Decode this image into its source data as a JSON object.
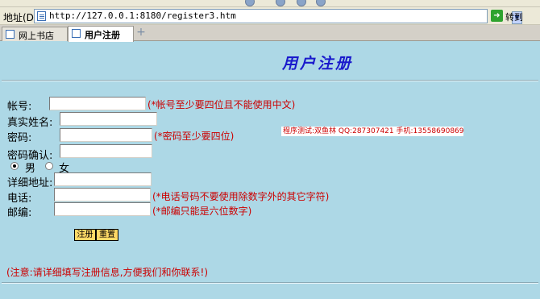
{
  "browser": {
    "address_label": "地址(D)",
    "url": "http://127.0.0.1:8180/register3.htm",
    "go_label": "转到"
  },
  "tabs": [
    {
      "label": "网上书店"
    },
    {
      "label": "用户注册"
    }
  ],
  "form": {
    "title": "用户注册",
    "fields": {
      "account": {
        "label": "帐号:",
        "value": "",
        "hint": "(*帐号至少要四位且不能使用中文)"
      },
      "realname": {
        "label": "真实姓名:",
        "value": ""
      },
      "password": {
        "label": "密码:",
        "value": "",
        "hint": "(*密码至少要四位)"
      },
      "password_confirm": {
        "label": "密码确认:",
        "value": ""
      },
      "address": {
        "label": "详细地址:",
        "value": ""
      },
      "phone": {
        "label": "电话:",
        "value": "",
        "hint": "(*电话号码不要使用除数字外的其它字符)"
      },
      "zipcode": {
        "label": "邮编:",
        "value": "",
        "hint": "(*邮编只能是六位数字)"
      }
    },
    "gender": {
      "options": [
        {
          "label": "男",
          "selected": true
        },
        {
          "label": "女",
          "selected": false
        }
      ]
    },
    "buttons": {
      "submit": "注册",
      "reset": "重置"
    },
    "credit": "程序测试:双鱼林 QQ:287307421 手机:13558690869",
    "notice": "(注意:请详细填写注册信息,方便我们和你联系!)"
  }
}
